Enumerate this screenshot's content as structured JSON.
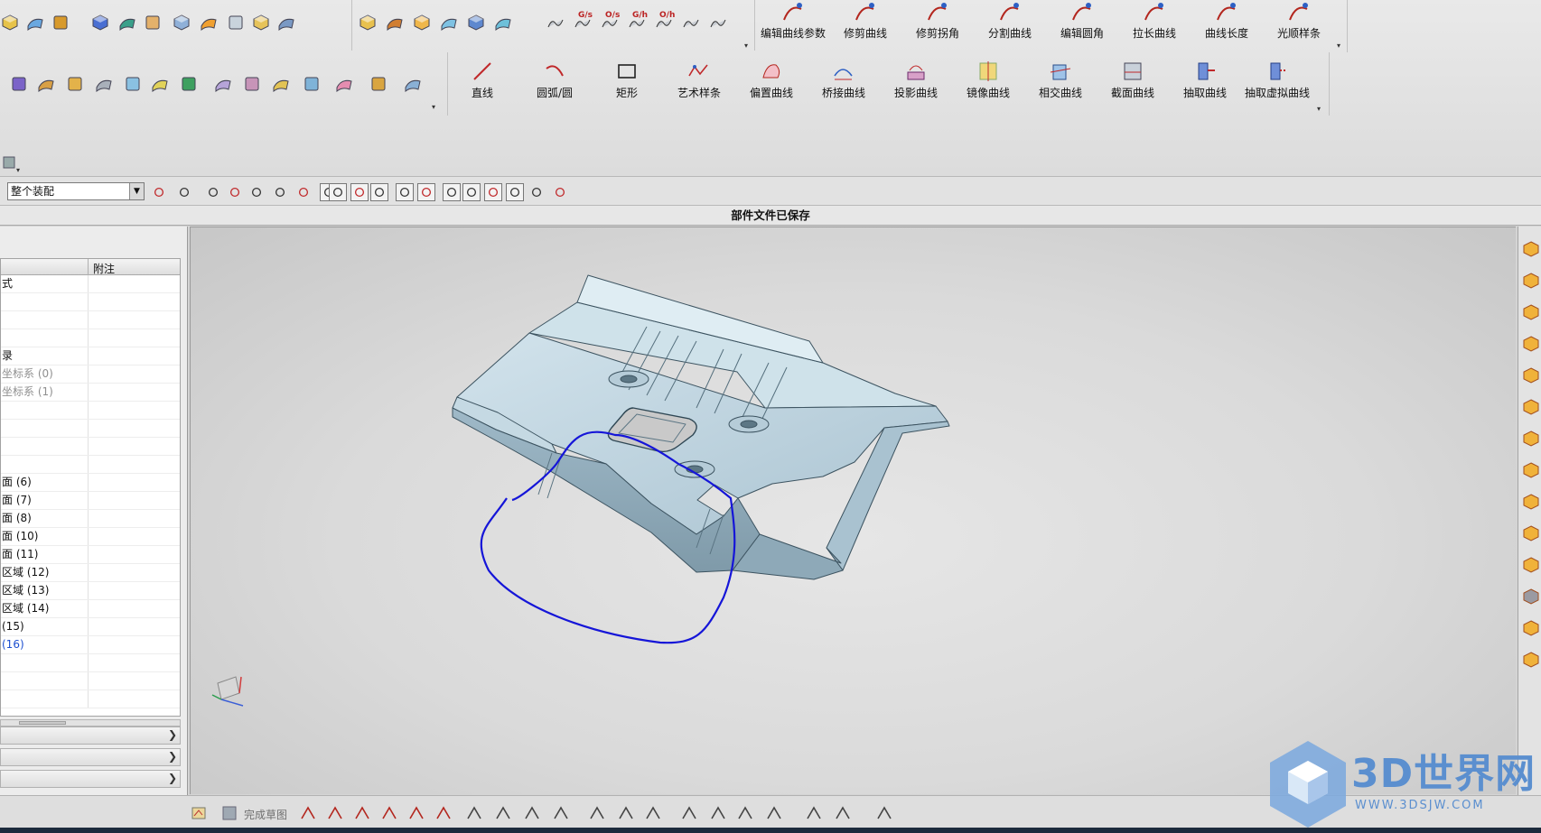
{
  "ribbon": {
    "curve_edit_buttons": [
      {
        "label": "编辑曲线参数",
        "icon": "edit-curve-params-icon"
      },
      {
        "label": "修剪曲线",
        "icon": "trim-curve-icon"
      },
      {
        "label": "修剪拐角",
        "icon": "trim-corner-icon"
      },
      {
        "label": "分割曲线",
        "icon": "divide-curve-icon"
      },
      {
        "label": "编辑圆角",
        "icon": "edit-fillet-icon"
      },
      {
        "label": "拉长曲线",
        "icon": "stretch-curve-icon"
      },
      {
        "label": "曲线长度",
        "icon": "curve-length-icon"
      },
      {
        "label": "光顺样条",
        "icon": "smooth-spline-icon"
      }
    ],
    "curve_create_buttons": [
      {
        "label": "直线",
        "icon": "line-icon"
      },
      {
        "label": "圆弧/圆",
        "icon": "arc-circle-icon"
      },
      {
        "label": "矩形",
        "icon": "rectangle-icon"
      },
      {
        "label": "艺术样条",
        "icon": "studio-spline-icon"
      },
      {
        "label": "偏置曲线",
        "icon": "offset-curve-icon"
      },
      {
        "label": "桥接曲线",
        "icon": "bridge-curve-icon"
      },
      {
        "label": "投影曲线",
        "icon": "project-curve-icon"
      },
      {
        "label": "镜像曲线",
        "icon": "mirror-curve-icon"
      },
      {
        "label": "相交曲线",
        "icon": "intersection-curve-icon"
      },
      {
        "label": "截面曲线",
        "icon": "section-curve-icon"
      },
      {
        "label": "抽取曲线",
        "icon": "extract-curve-icon"
      },
      {
        "label": "抽取虚拟曲线",
        "icon": "extract-virtual-curve-icon"
      }
    ],
    "continuity_labels": [
      "G/s",
      "O/s",
      "G/h",
      "O/h"
    ]
  },
  "selection": {
    "filter_value": "整个装配"
  },
  "status": {
    "message": "部件文件已保存"
  },
  "navigator": {
    "column_note": "附注",
    "rows": [
      {
        "text": "式",
        "style": "normal"
      },
      {
        "text": "",
        "style": "normal"
      },
      {
        "text": "",
        "style": "normal"
      },
      {
        "text": "",
        "style": "normal"
      },
      {
        "text": "录",
        "style": "normal"
      },
      {
        "text": "坐标系 (0)",
        "style": "gray"
      },
      {
        "text": "坐标系 (1)",
        "style": "gray"
      },
      {
        "text": "",
        "style": "normal"
      },
      {
        "text": "",
        "style": "normal"
      },
      {
        "text": "",
        "style": "normal"
      },
      {
        "text": "",
        "style": "normal"
      },
      {
        "text": "面 (6)",
        "style": "normal"
      },
      {
        "text": "面 (7)",
        "style": "normal"
      },
      {
        "text": "面 (8)",
        "style": "normal"
      },
      {
        "text": "面 (10)",
        "style": "normal"
      },
      {
        "text": "面 (11)",
        "style": "normal"
      },
      {
        "text": "区域 (12)",
        "style": "normal"
      },
      {
        "text": "区域 (13)",
        "style": "normal"
      },
      {
        "text": "区域 (14)",
        "style": "normal"
      },
      {
        "text": "(15)",
        "style": "normal"
      },
      {
        "text": "(16)",
        "style": "blue"
      },
      {
        "text": "",
        "style": "normal"
      },
      {
        "text": "",
        "style": "normal"
      },
      {
        "text": "",
        "style": "normal"
      }
    ]
  },
  "sketch_toolbar": {
    "finish_sketch_label": "完成草图"
  },
  "watermark": {
    "title": "3D世界网",
    "url": "WWW.3DSJW.COM"
  },
  "colors": {
    "part_face": "#b9d2de",
    "part_edge": "#3c5360",
    "sketch_curve": "#1515d8",
    "accent": "#5b8fcf"
  }
}
